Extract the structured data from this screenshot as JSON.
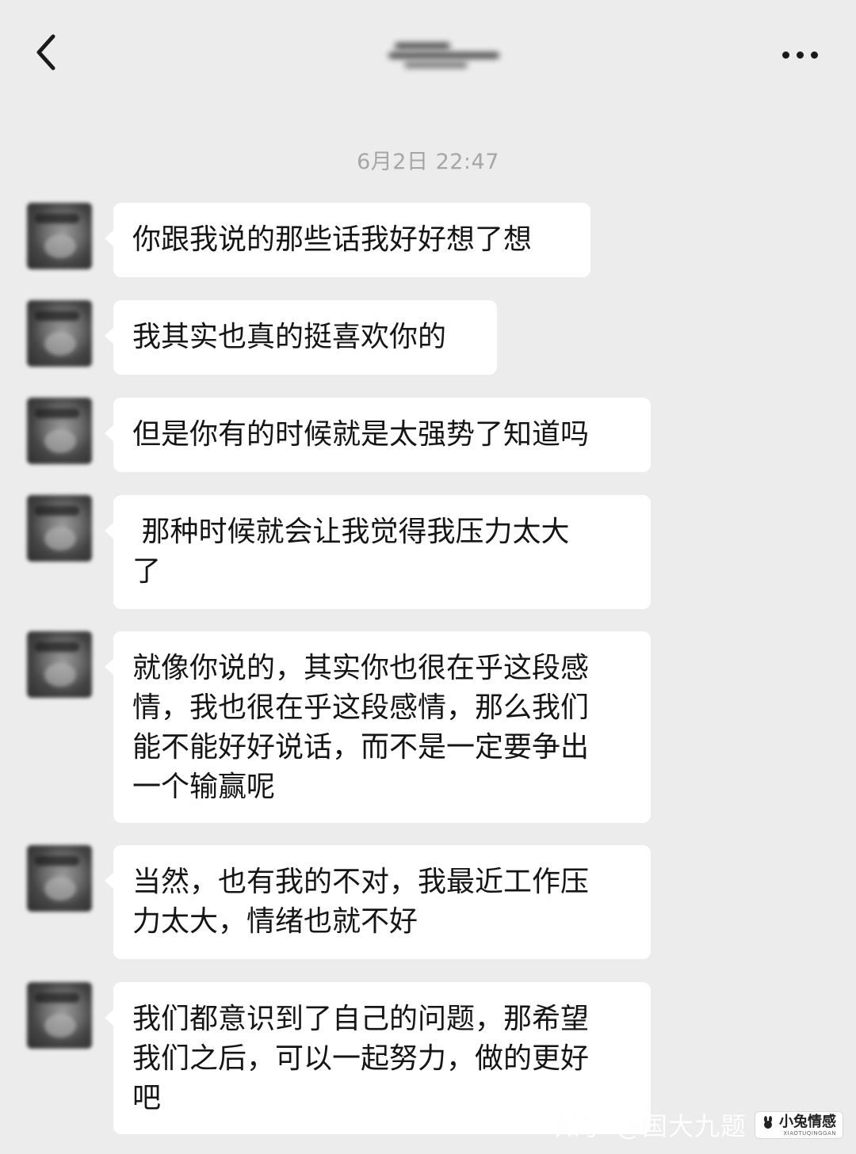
{
  "header": {
    "back_icon": "chevron-left-icon",
    "more_icon": "more-dots-icon"
  },
  "timestamp": "6月2日 22:47",
  "messages": [
    {
      "text": "你跟我说的那些话我好好想了想"
    },
    {
      "text": "我其实也真的挺喜欢你的"
    },
    {
      "text": "但是你有的时候就是太强势了知道吗"
    },
    {
      "text": " 那种时候就会让我觉得我压力太大\n了"
    },
    {
      "text": "就像你说的，其实你也很在乎这段感\n情，我也很在乎这段感情，那么我们\n能不能好好说话，而不是一定要争出\n一个输赢呢"
    },
    {
      "text": "当然，也有我的不对，我最近工作压\n力太大，情绪也就不好"
    },
    {
      "text": "我们都意识到了自己的问题，那希望\n我们之后，可以一起努力，做的更好\n吧"
    }
  ],
  "watermark": {
    "text": "知乎 @国大九题",
    "logo_main": "小兔情感",
    "logo_sub": "XIAOTUQINGGAN"
  },
  "colors": {
    "background": "#ececec",
    "bubble": "#ffffff",
    "text": "#151515",
    "timestamp": "#a6a6a6"
  }
}
